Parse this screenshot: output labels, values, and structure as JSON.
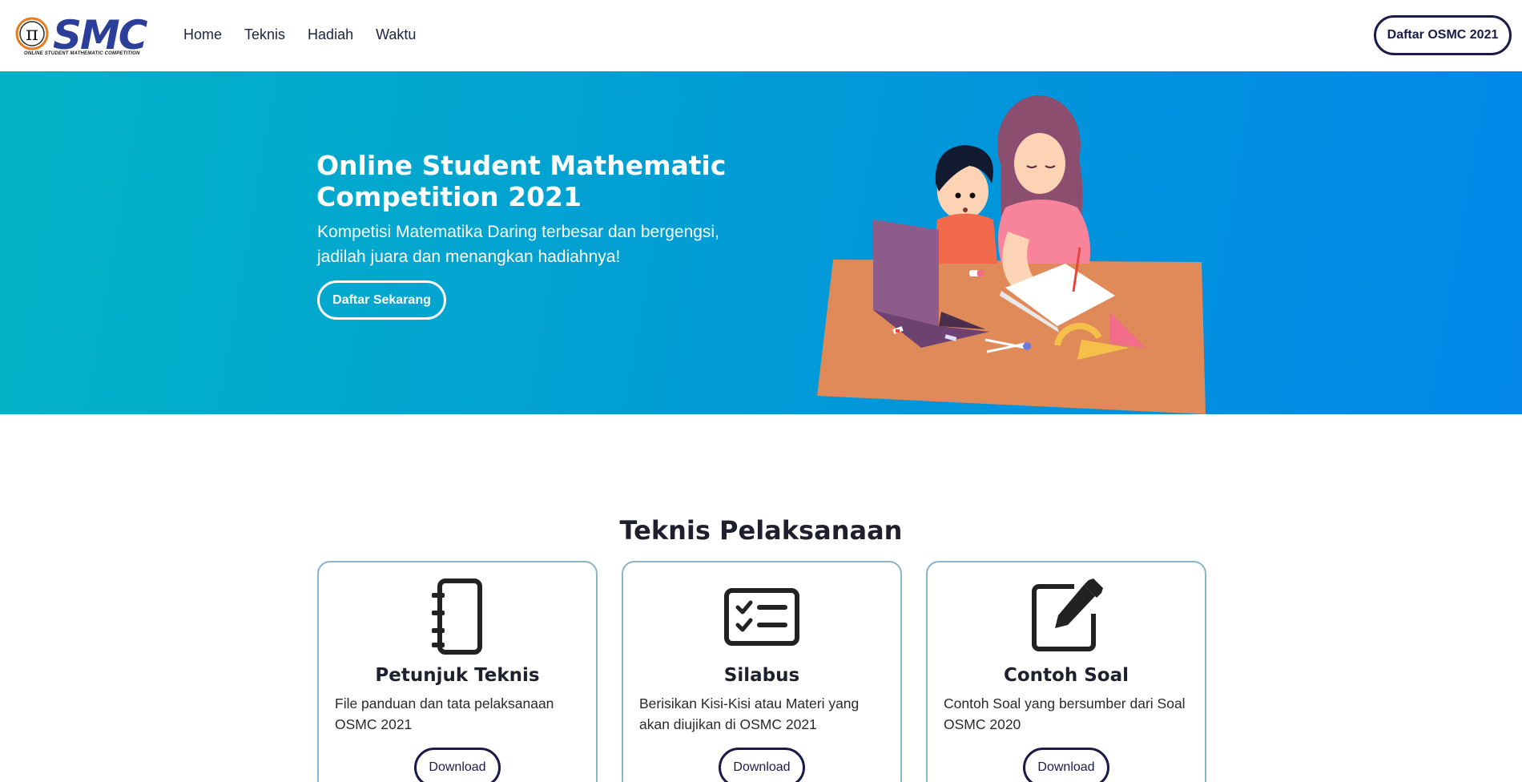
{
  "brand": {
    "logo_text": "SMC",
    "logo_symbol": "π",
    "tagline": "ONLINE STUDENT MATHEMATIC COMPETITION"
  },
  "nav": {
    "links": [
      {
        "label": "Home"
      },
      {
        "label": "Teknis"
      },
      {
        "label": "Hadiah"
      },
      {
        "label": "Waktu"
      }
    ],
    "cta_label": "Daftar OSMC 2021"
  },
  "hero": {
    "title": "Online Student Mathematic Competition 2021",
    "subtitle": "Kompetisi Matematika Daring terbesar dan bergengsi, jadilah juara dan menangkan hadiahnya!",
    "button_label": "Daftar Sekarang"
  },
  "section": {
    "title": "Teknis Pelaksanaan",
    "cards": [
      {
        "icon": "notebook-icon",
        "title": "Petunjuk Teknis",
        "description": "File panduan dan tata pelaksanaan OSMC 2021",
        "button_label": "Download"
      },
      {
        "icon": "checklist-icon",
        "title": "Silabus",
        "description": "Berisikan Kisi-Kisi atau Materi yang akan diujikan di OSMC 2021",
        "button_label": "Download"
      },
      {
        "icon": "edit-icon",
        "title": "Contoh Soal",
        "description": "Contoh Soal yang bersumber dari Soal OSMC 2020",
        "button_label": "Download"
      }
    ]
  },
  "colors": {
    "navy": "#1b1b4a",
    "hero_start": "#03b4c6",
    "hero_end": "#0287e9",
    "card_border": "#8bb4c9",
    "logo_blue": "#2b3f9a",
    "logo_orange": "#e87b1e"
  }
}
